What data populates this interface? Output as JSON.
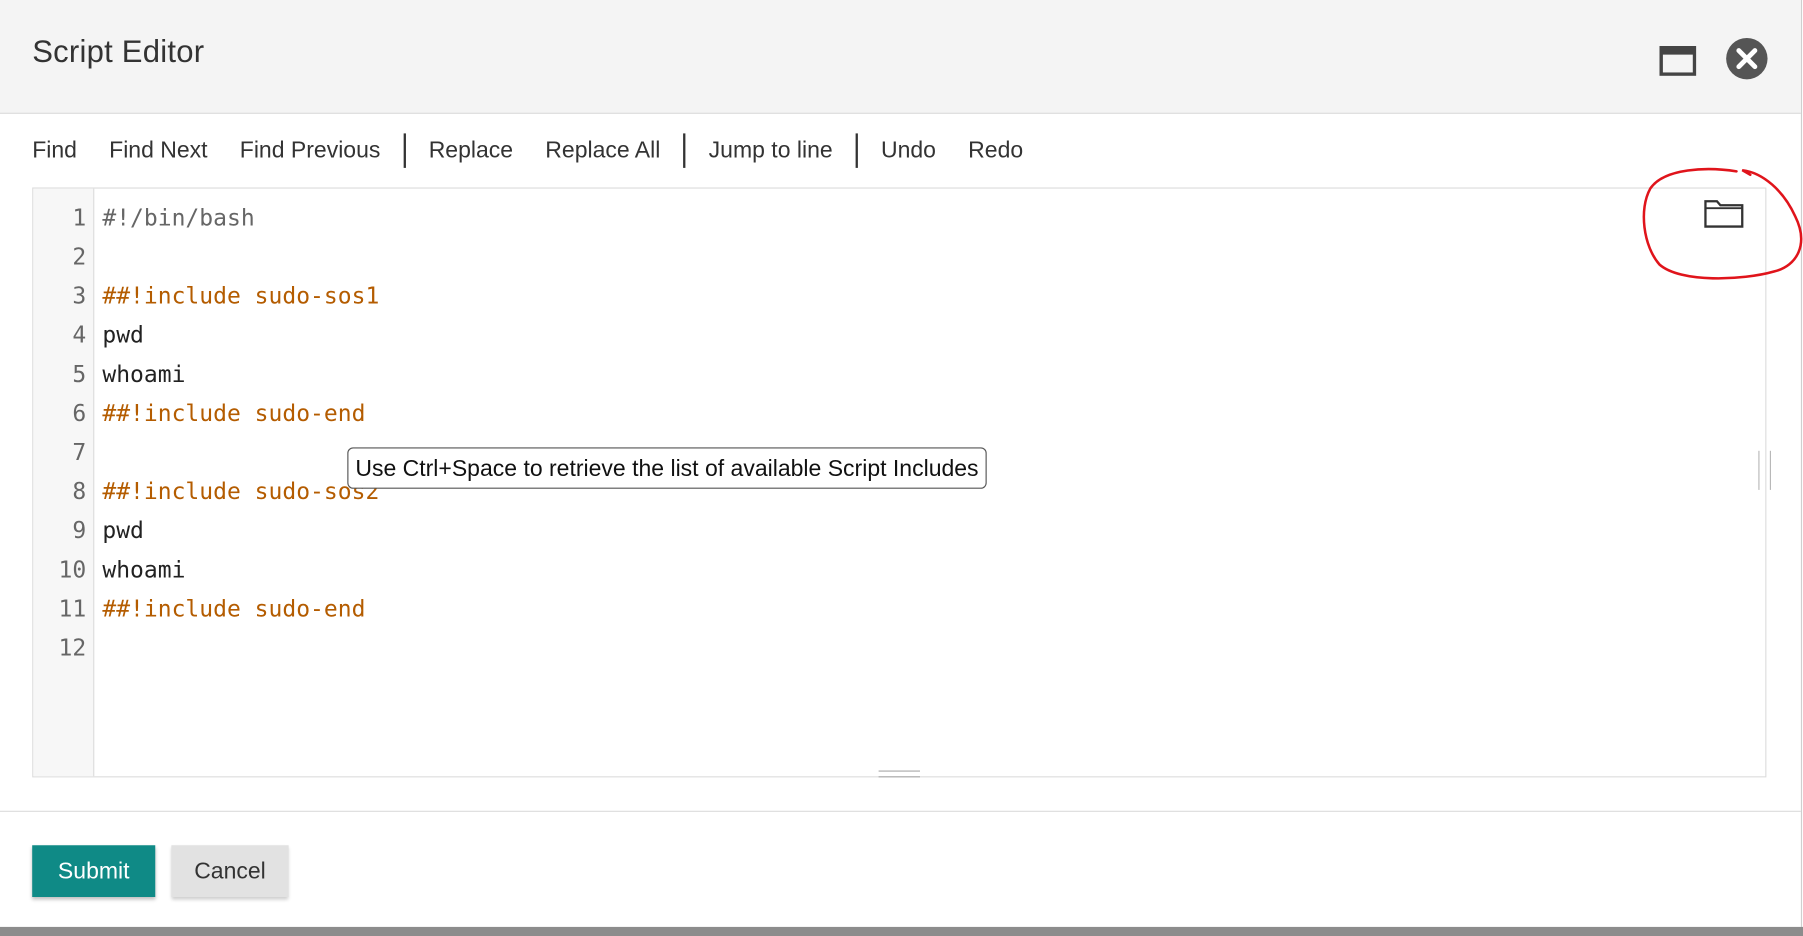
{
  "dialog": {
    "title": "Script Editor",
    "maximize_icon": "window-maximize-icon",
    "close_icon": "close-circle-icon"
  },
  "toolbar": {
    "find": "Find",
    "find_next": "Find Next",
    "find_previous": "Find Previous",
    "replace": "Replace",
    "replace_all": "Replace All",
    "jump_to_line": "Jump to line",
    "undo": "Undo",
    "redo": "Redo"
  },
  "editor": {
    "lines": [
      {
        "num": "1",
        "text": "#!/bin/bash"
      },
      {
        "num": "2",
        "text": ""
      },
      {
        "num": "3",
        "text": "##!include sudo-sos1"
      },
      {
        "num": "4",
        "text": "pwd"
      },
      {
        "num": "5",
        "text": "whoami"
      },
      {
        "num": "6",
        "text": "##!include sudo-end"
      },
      {
        "num": "7",
        "text": ""
      },
      {
        "num": "8",
        "text": "##!include sudo-sos2"
      },
      {
        "num": "9",
        "text": "pwd"
      },
      {
        "num": "10",
        "text": "whoami"
      },
      {
        "num": "11",
        "text": "##!include sudo-end"
      },
      {
        "num": "12",
        "text": ""
      }
    ],
    "tooltip": "Use Ctrl+Space to retrieve the list of available Script Includes",
    "folder_icon": "folder-icon"
  },
  "colors": {
    "submit_bg": "#0f8a86",
    "directive_text": "#b45c00",
    "annotation_circle": "#e0141b"
  },
  "footer": {
    "submit_label": "Submit",
    "cancel_label": "Cancel"
  }
}
